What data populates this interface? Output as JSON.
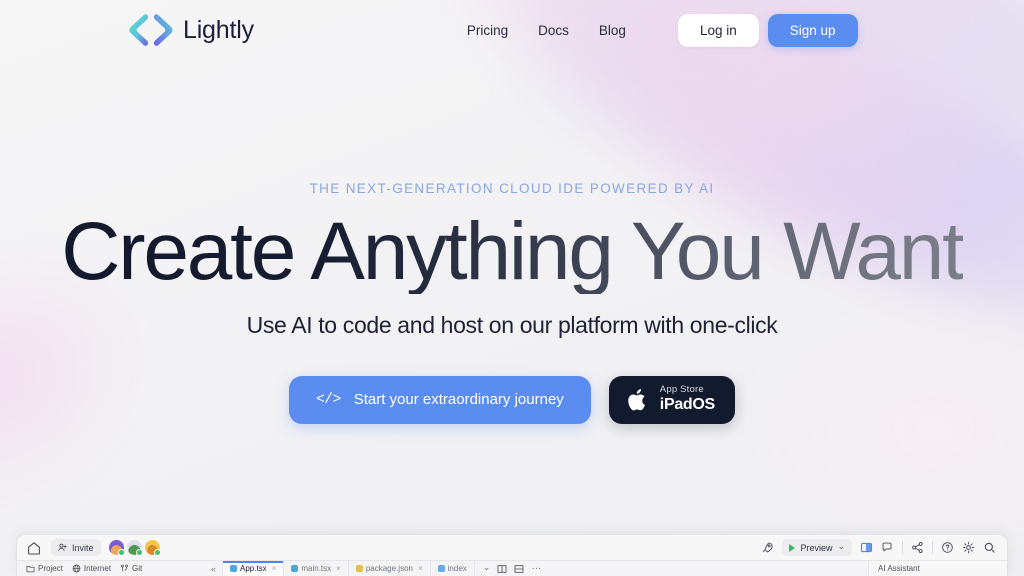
{
  "brand": {
    "name": "Lightly",
    "logo_icon": "code-brackets-logo",
    "gradient_from": "#4fe0c8",
    "gradient_to": "#6c5ce7"
  },
  "nav": {
    "links": [
      {
        "label": "Pricing"
      },
      {
        "label": "Docs"
      },
      {
        "label": "Blog"
      }
    ],
    "login_label": "Log in",
    "signup_label": "Sign up",
    "signup_color": "#5b8cf0"
  },
  "hero": {
    "eyebrow": "THE NEXT-GENERATION CLOUD IDE POWERED BY AI",
    "eyebrow_color": "#8ba7e0",
    "headline": "Create Anything You Want",
    "subheadline": "Use AI to code and host on our platform with one-click",
    "primary_cta": {
      "code_glyph": "</>",
      "label": "Start your extraordinary journey",
      "color": "#5b8cf0"
    },
    "store_cta": {
      "icon": "apple-icon",
      "small_label": "App Store",
      "big_label": "iPadOS",
      "color": "#121a2e"
    }
  },
  "ide": {
    "home_icon": "home-icon",
    "invite": {
      "icon": "person-add-icon",
      "label": "Invite"
    },
    "collaborators": [
      {
        "name": "collaborator-1",
        "status": "online"
      },
      {
        "name": "collaborator-2",
        "status": "online"
      },
      {
        "name": "collaborator-3",
        "status": "online"
      }
    ],
    "right_tools": {
      "rocket_icon": "rocket-icon",
      "preview_label": "Preview",
      "preview_chevron": "⌄",
      "layout_icon": "layout-panel-icon",
      "chat_icon": "chat-bubble-icon",
      "share_icon": "share-icon",
      "help_icon": "help-circle-icon",
      "settings_icon": "gear-icon",
      "search_icon": "search-icon"
    },
    "tree_tabs": [
      {
        "label": "Project",
        "icon": "folder-icon"
      },
      {
        "label": "Internet",
        "icon": "globe-icon"
      },
      {
        "label": "Git",
        "icon": "git-branch-icon"
      }
    ],
    "collapse_glyph": "«",
    "file_tabs": [
      {
        "label": "App.tsx",
        "kind": "tsx",
        "active": true,
        "close": "×"
      },
      {
        "label": "main.tsx",
        "kind": "tsx",
        "active": false,
        "close": "×"
      },
      {
        "label": "package.json",
        "kind": "json",
        "active": false,
        "close": "×"
      },
      {
        "label": "index",
        "kind": "html",
        "active": false,
        "close": ""
      }
    ],
    "tab_tools": {
      "chevron_down": "⌄",
      "split_vertical_icon": "split-vertical-icon",
      "split_horizontal_icon": "split-horizontal-icon",
      "more_icon": "more-horizontal-icon"
    },
    "ai_panel_label": "AI Assistant"
  }
}
